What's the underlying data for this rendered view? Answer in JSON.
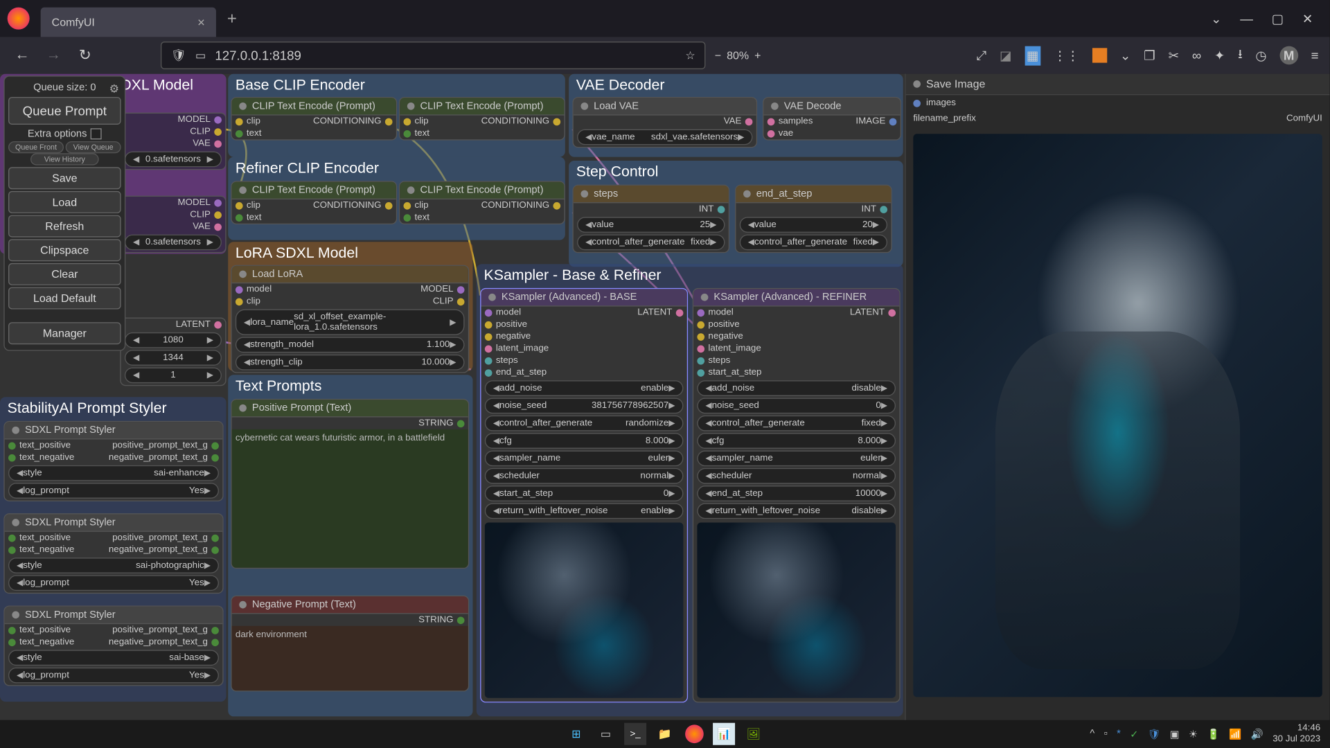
{
  "browser": {
    "tab_title": "ComfyUI",
    "url": "127.0.0.1:8189",
    "zoom": "80%"
  },
  "menu": {
    "queue_size": "Queue size: 0",
    "queue_prompt": "Queue Prompt",
    "extra_options": "Extra options",
    "queue_front": "Queue Front",
    "view_queue": "View Queue",
    "view_history": "View History",
    "save": "Save",
    "load": "Load",
    "refresh": "Refresh",
    "clipspace": "Clipspace",
    "clear": "Clear",
    "load_default": "Load Default",
    "manager": "Manager"
  },
  "groups": {
    "base_refiner": "Base & Refiner SDXL Model",
    "base_clip": "Base CLIP Encoder",
    "refiner_clip": "Refiner CLIP Encoder",
    "lora": "LoRA SDXL Model",
    "text_prompts": "Text Prompts",
    "styler": "StabilityAI Prompt Styler",
    "vae_decoder": "VAE Decoder",
    "step_control": "Step Control",
    "ksampler": "KSampler - Base & Refiner"
  },
  "nodes": {
    "clip_encode": "CLIP Text Encode (Prompt)",
    "load_lora": "Load LoRA",
    "pos_prompt": "Positive Prompt (Text)",
    "neg_prompt": "Negative Prompt (Text)",
    "styler": "SDXL Prompt Styler",
    "load_vae": "Load VAE",
    "vae_decode": "VAE Decode",
    "steps": "steps",
    "end_at_step": "end_at_step",
    "ksampler_base": "KSampler (Advanced) - BASE",
    "ksampler_refiner": "KSampler (Advanced) - REFINER",
    "save_image": "Save Image"
  },
  "slots": {
    "clip": "clip",
    "text": "text",
    "conditioning": "CONDITIONING",
    "model": "model",
    "MODEL": "MODEL",
    "CLIP": "CLIP",
    "VAE": "VAE",
    "latent": "LATENT",
    "string": "STRING",
    "image": "IMAGE",
    "int": "INT",
    "samples": "samples",
    "vae": "vae",
    "images": "images",
    "text_positive": "text_positive",
    "text_negative": "text_negative",
    "positive_prompt": "positive_prompt_text_g",
    "negative_prompt": "negative_prompt_text_g",
    "positive": "positive",
    "negative": "negative",
    "latent_image": "latent_image",
    "steps": "steps",
    "end_at_step": "end_at_step",
    "start_at_step": "start_at_step",
    "filename_prefix": "filename_prefix"
  },
  "widgets": {
    "lora_name": "lora_name",
    "lora_val": "sd_xl_offset_example-lora_1.0.safetensors",
    "strength_model": "strength_model",
    "strength_model_val": "1.100",
    "strength_clip": "strength_clip",
    "strength_clip_val": "10.000",
    "style": "style",
    "log_prompt": "log_prompt",
    "yes": "Yes",
    "sai_enhance": "sai-enhance",
    "sai_photo": "sai-photographic",
    "sai_base": "sai-base",
    "vae_name": "vae_name",
    "vae_val": "sdxl_vae.safetensors",
    "value": "value",
    "steps_val": "25",
    "end_val": "20",
    "control_after": "control_after_generate",
    "fixed": "fixed",
    "randomize": "randomize",
    "add_noise": "add_noise",
    "enable": "enable",
    "disable": "disable",
    "noise_seed": "noise_seed",
    "seed_base": "381756778962507",
    "seed_ref": "0",
    "cfg": "cfg",
    "cfg_val": "8.000",
    "sampler_name": "sampler_name",
    "euler": "euler",
    "scheduler": "scheduler",
    "normal": "normal",
    "start_at_step": "start_at_step",
    "start_val": "0",
    "end_at_step": "end_at_step",
    "end_ref": "10000",
    "return_leftover": "return_with_leftover_noise",
    "comfyui": "ComfyUI",
    "safetensors": "0.safetensors",
    "h1080": "1080",
    "w1344": "1344",
    "b1": "1"
  },
  "prompts": {
    "positive": "cybernetic cat wears futuristic armor, in a battlefield",
    "negative": "dark environment"
  },
  "taskbar": {
    "time": "14:46",
    "date": "30 Jul 2023"
  }
}
